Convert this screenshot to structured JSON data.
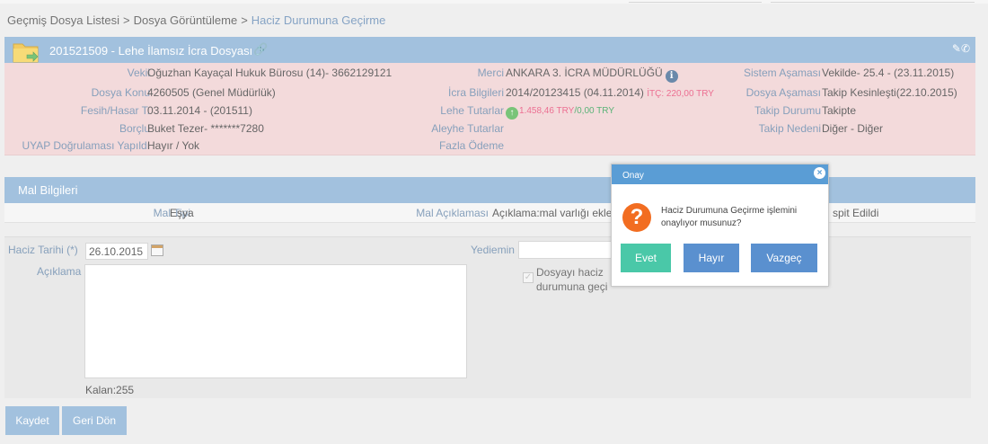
{
  "breadcrumb": {
    "items": [
      "Geçmiş Dosya Listesi",
      "Dosya Görüntüleme"
    ],
    "current": "Haciz Durumuna Geçirme",
    "separator": ">"
  },
  "file": {
    "title": "201521509 - Lehe İlamsız İcra Dosyası",
    "fields": {
      "vekil_label": "Vekil",
      "vekil_value": "Oğuzhan Kayaçal Hukuk Bürosu  (14)- 3662129121",
      "dosya_konu_label": "Dosya Konu",
      "dosya_konu_value": "4260505 (Genel Müdürlük)",
      "fesih_label": "Fesih/Hasar T.",
      "fesih_value": "03.11.2014 - (201511)",
      "borclu_label": "Borçlu",
      "borclu_value": "Buket Tezer- *******7280",
      "uyap_label": "UYAP Doğrulaması Yapıldı",
      "uyap_value": "Hayır / Yok",
      "merci_label": "Merci",
      "merci_value": "ANKARA 3. İCRA MÜDÜRLÜĞÜ",
      "icra_label": "İcra Bilgileri",
      "icra_value": "2014/20123415 (04.11.2014)",
      "itc_value": "İTÇ:  220,00 TRY",
      "lehe_label": "Lehe Tutarlar",
      "lehe_red": "1.458,46 TRY",
      "lehe_green": "/0,00 TRY",
      "aleyhe_label": "Aleyhe Tutarlar",
      "fazla_label": "Fazla Ödeme",
      "sistem_label": "Sistem Aşaması",
      "sistem_value": "Vekilde- 25.4 - (23.11.2015)",
      "dosya_asamasi_label": "Dosya Aşaması",
      "dosya_asamasi_value": "Takip Kesinleşti(22.10.2015)",
      "takip_durumu_label": "Takip Durumu",
      "takip_durumu_value": "Takipte",
      "takip_nedeni_label": "Takip Nedeni",
      "takip_nedeni_value": "Diğer - Diğer"
    }
  },
  "mal": {
    "header": "Mal Bilgileri",
    "mal_tipi_label": "Mal Tipi",
    "mal_tipi_value": "Eşya",
    "mal_aciklamasi_label": "Mal Açıklaması",
    "mal_aciklamasi_value": "Açıklama:mal varlığı ekle",
    "tespit_value": "spit Edildi"
  },
  "form": {
    "haciz_tarihi_label": "Haciz Tarihi (*)",
    "haciz_tarihi_value": "26.10.2015",
    "aciklama_label": "Açıklama",
    "kalan_label": "Kalan:255",
    "yediemin_label": "Yediemin",
    "checkbox_label": "Dosyayı haciz durumuna geçi"
  },
  "buttons": {
    "kaydet": "Kaydet",
    "geri_don": "Geri Dön"
  },
  "dialog": {
    "title": "Onay",
    "message": "Haciz Durumuna Geçirme işlemini onaylıyor musunuz?",
    "evet": "Evet",
    "hayir": "Hayır",
    "vazgec": "Vazgeç"
  },
  "colors": {
    "panel_header": "#8eb4d7",
    "panel_body": "#f1d2d4",
    "dialog_header": "#5a9dd5",
    "evet": "#4ac8a8",
    "hayir": "#5a90cf",
    "vazgec": "#5a90cf",
    "question_icon": "#f26d21"
  },
  "icons": [
    "folder-icon",
    "link-icon",
    "edit-icon",
    "phone-icon",
    "info-icon",
    "arrow-up-icon",
    "calendar-icon",
    "question-icon",
    "close-icon"
  ]
}
